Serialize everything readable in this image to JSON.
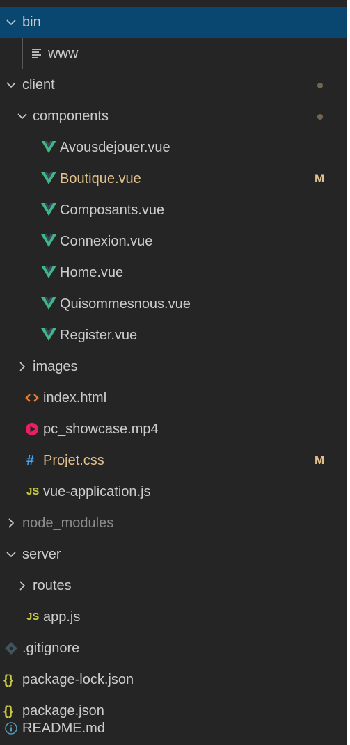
{
  "colors": {
    "panel_background": "#252526",
    "selection": "#094771",
    "text": "#cccccc",
    "modified": "#e2c08d",
    "ignored": "#8c8c8c",
    "vue": "#41b883",
    "javascript": "#cbcb41",
    "css": "#42a5f5",
    "html": "#e37933",
    "video": "#e91e63",
    "json": "#cbcb41",
    "info": "#519aba"
  },
  "tree": {
    "bin": {
      "label": "bin",
      "icon": "chevron-down-icon"
    },
    "www": {
      "label": "www",
      "icon": "text-file-icon"
    },
    "client": {
      "label": "client",
      "icon": "chevron-down-icon",
      "decoration": "modified-dot"
    },
    "components": {
      "label": "components",
      "icon": "chevron-down-icon",
      "decoration": "modified-dot"
    },
    "avousdejouer": {
      "label": "Avousdejouer.vue",
      "icon": "vue-icon"
    },
    "boutique": {
      "label": "Boutique.vue",
      "icon": "vue-icon",
      "status": "M"
    },
    "composants": {
      "label": "Composants.vue",
      "icon": "vue-icon"
    },
    "connexion": {
      "label": "Connexion.vue",
      "icon": "vue-icon"
    },
    "home": {
      "label": "Home.vue",
      "icon": "vue-icon"
    },
    "quisommesnous": {
      "label": "Quisommesnous.vue",
      "icon": "vue-icon"
    },
    "register": {
      "label": "Register.vue",
      "icon": "vue-icon"
    },
    "images": {
      "label": "images",
      "icon": "chevron-right-icon"
    },
    "index_html": {
      "label": "index.html",
      "icon": "html-icon"
    },
    "pc_showcase": {
      "label": "pc_showcase.mp4",
      "icon": "video-play-icon"
    },
    "projet_css": {
      "label": "Projet.css",
      "icon": "css-hash-icon",
      "icon_text": "#",
      "status": "M"
    },
    "vue_application": {
      "label": "vue-application.js",
      "icon": "javascript-icon",
      "icon_text": "JS"
    },
    "node_modules": {
      "label": "node_modules",
      "icon": "chevron-right-icon"
    },
    "server": {
      "label": "server",
      "icon": "chevron-down-icon"
    },
    "routes": {
      "label": "routes",
      "icon": "chevron-right-icon"
    },
    "app_js": {
      "label": "app.js",
      "icon": "javascript-icon",
      "icon_text": "JS"
    },
    "gitignore": {
      "label": ".gitignore",
      "icon": "git-icon"
    },
    "package_lock": {
      "label": "package-lock.json",
      "icon": "json-braces-icon",
      "icon_text": "{}"
    },
    "package_json": {
      "label": "package.json",
      "icon": "json-braces-icon",
      "icon_text": "{}"
    },
    "readme": {
      "label": "README.md",
      "icon": "info-icon"
    }
  }
}
